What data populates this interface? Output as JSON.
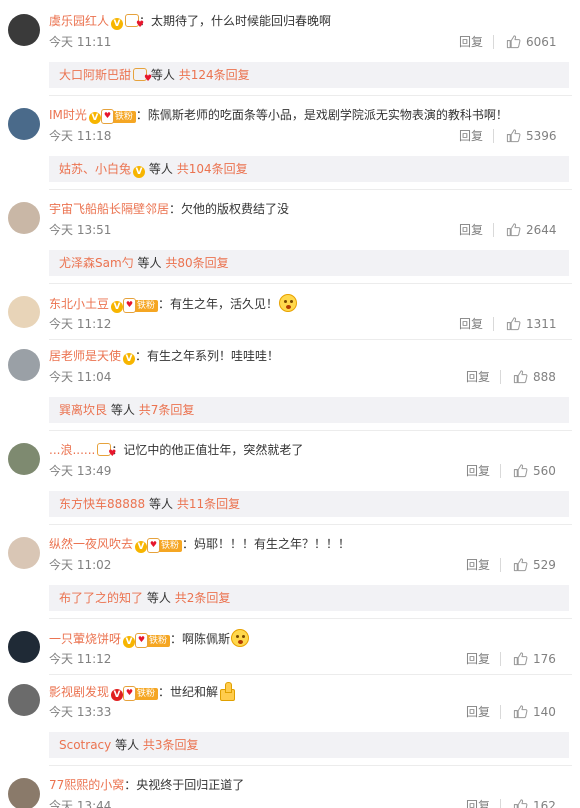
{
  "common": {
    "reply_label": "回复",
    "deng_ren": "等人"
  },
  "comments": [
    {
      "username": "虞乐园红人",
      "badges": [
        "v",
        "crown"
      ],
      "text": "：太期待了，什么时候能回归春晚啊",
      "emoji": "",
      "time": "今天 11:11",
      "likes": "6061",
      "sub": {
        "user": "大口阿斯巴甜",
        "user_badges": [
          "crown"
        ],
        "count": "共124条回复"
      },
      "avatar_color": "#3a3a3a"
    },
    {
      "username": "IM时光",
      "badges": [
        "v",
        "fan"
      ],
      "fan_label": "铁粉",
      "text": "：陈佩斯老师的吃面条等小品，是戏剧学院派无实物表演的教科书啊！",
      "emoji": "",
      "time": "今天 11:18",
      "likes": "5396",
      "sub": {
        "user": "姑苏、小白兔",
        "user_badges": [
          "v"
        ],
        "count": "共104条回复"
      },
      "avatar_color": "#4a6a8a"
    },
    {
      "username": "宇宙飞船船长隔壁邻居",
      "badges": [],
      "text": "：欠他的版权费结了没",
      "emoji": "",
      "time": "今天 13:51",
      "likes": "2644",
      "sub": {
        "user": "尤泽森Sam勺",
        "user_badges": [],
        "count": "共80条回复"
      },
      "avatar_color": "#c9b7a6"
    },
    {
      "username": "东北小土豆",
      "badges": [
        "v",
        "fan"
      ],
      "fan_label": "铁粉",
      "text": "：有生之年，活久见！",
      "emoji": "scream",
      "time": "今天 11:12",
      "likes": "1311",
      "sub": null,
      "avatar_color": "#e8d4b8"
    },
    {
      "username": "居老师是天使",
      "badges": [
        "v"
      ],
      "text": "：有生之年系列！哇哇哇！",
      "emoji": "",
      "time": "今天 11:04",
      "likes": "888",
      "sub": {
        "user": "巽离坎艮",
        "user_badges": [],
        "count": "共7条回复"
      },
      "avatar_color": "#9aa0a6"
    },
    {
      "username": "...浪......",
      "badges": [
        "crown"
      ],
      "text": "：记忆中的他正值壮年，突然就老了",
      "emoji": "",
      "time": "今天 13:49",
      "likes": "560",
      "sub": {
        "user": "东方快车88888",
        "user_badges": [],
        "count": "共11条回复"
      },
      "avatar_color": "#7e8a70"
    },
    {
      "username": "纵然一夜风吹去",
      "badges": [
        "v",
        "fan"
      ],
      "fan_label": "铁粉",
      "text": "：妈耶！！！有生之年？！！！",
      "emoji": "",
      "time": "今天 11:02",
      "likes": "529",
      "sub": {
        "user": "布了了之的知了",
        "user_badges": [],
        "count": "共2条回复"
      },
      "avatar_color": "#d9c6b5"
    },
    {
      "username": "一只葷烧饼呀",
      "badges": [
        "v",
        "fan"
      ],
      "fan_label": "铁粉",
      "text": "：啊陈佩斯",
      "emoji": "scream",
      "time": "今天 11:12",
      "likes": "176",
      "sub": null,
      "avatar_color": "#1f2a36"
    },
    {
      "username": "影视剧发现",
      "badges": [
        "vred",
        "fan"
      ],
      "fan_label": "铁粉",
      "text": "：世纪和解",
      "emoji": "thumb",
      "time": "今天 13:33",
      "likes": "140",
      "sub": {
        "user": "Scotracy",
        "user_badges": [],
        "count": "共3条回复"
      },
      "avatar_color": "#6b6b6b"
    },
    {
      "username": "77熙熙的小窝",
      "badges": [],
      "text": "：央视终于回归正道了",
      "emoji": "",
      "time": "今天 13:44",
      "likes": "162",
      "sub": null,
      "avatar_color": "#8a7a6a"
    }
  ]
}
